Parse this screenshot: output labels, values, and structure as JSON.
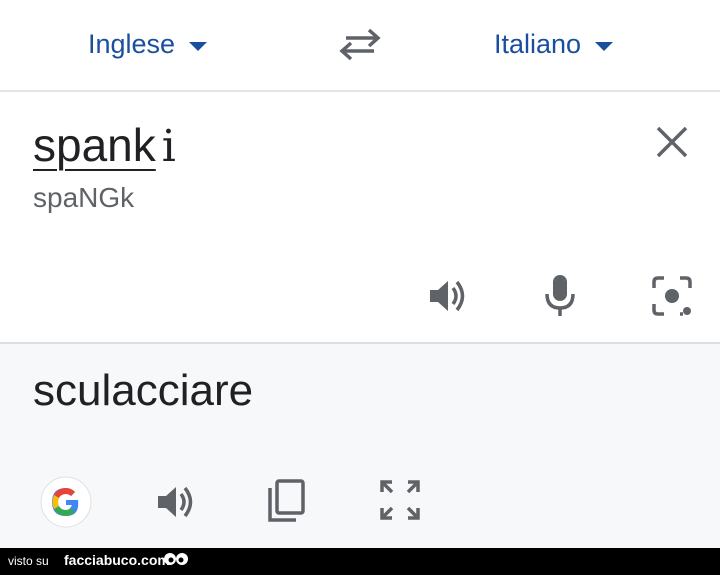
{
  "language_bar": {
    "source_language": "Inglese",
    "target_language": "Italiano"
  },
  "input": {
    "text": "spank",
    "cursor_char": "i",
    "transliteration": "spaNGk"
  },
  "output": {
    "text": "sculacciare"
  },
  "icons": {
    "swap": "swap-languages-icon",
    "clear": "close-icon",
    "listen_source": "speaker-icon",
    "microphone": "microphone-icon",
    "camera": "camera-lens-icon",
    "google": "google-logo-icon",
    "listen_target": "speaker-icon",
    "copy": "copy-icon",
    "fullscreen": "fullscreen-icon"
  },
  "colors": {
    "accent": "#1a4fa0",
    "icon_gray": "#5f6368",
    "text": "#202124",
    "output_bg": "#f7f8fa"
  },
  "footer": {
    "visto_label": "visto su",
    "brand": "facciabuco.com"
  }
}
